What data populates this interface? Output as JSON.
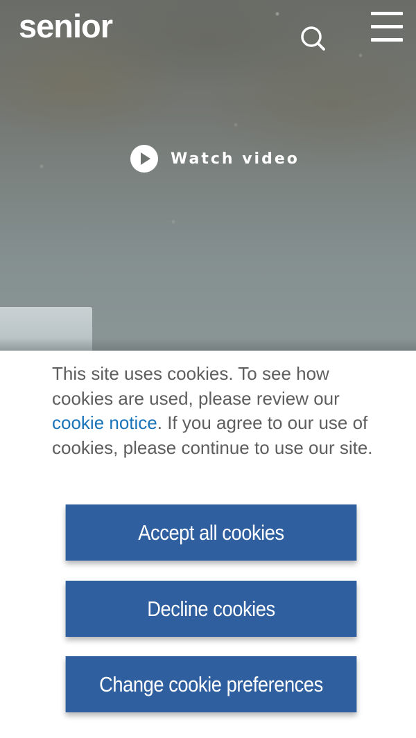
{
  "header": {
    "logo_text": "senior",
    "search_icon": "search-icon",
    "menu_icon": "hamburger-menu-icon"
  },
  "hero": {
    "watch_video_label": "Watch video",
    "play_icon": "play-icon"
  },
  "cookie_banner": {
    "text_before_link": "This site uses cookies. To see how cookies are used, please review our ",
    "link_text": "cookie notice",
    "text_after_link": ". If you agree to our use of cookies, please continue to use our site.",
    "accept_label": "Accept all cookies",
    "decline_label": "Decline cookies",
    "preferences_label": "Change cookie preferences"
  },
  "colors": {
    "button_bg": "#2f5f9e",
    "link": "#1a74b8",
    "body_text": "#5e5e5e"
  }
}
